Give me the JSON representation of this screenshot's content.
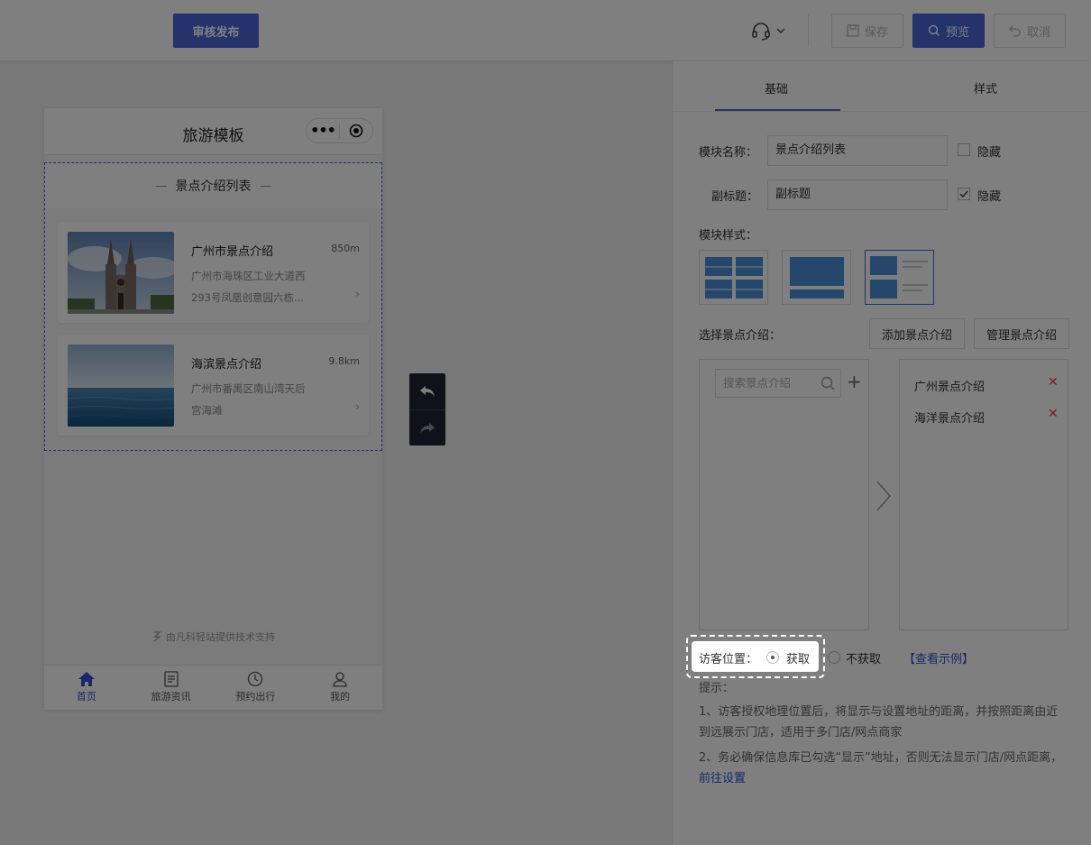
{
  "toolbar": {
    "publish_label": "审核发布",
    "save_label": "保存",
    "preview_label": "预览",
    "cancel_label": "取消"
  },
  "phone": {
    "title": "旅游模板",
    "module_title": "景点介绍列表",
    "cards": [
      {
        "name": "广州市景点介绍",
        "distance": "850m",
        "address_line1": "广州市海珠区工业大道西",
        "address_line2": "293号凤凰创意园六栋..."
      },
      {
        "name": "海滨景点介绍",
        "distance": "9.8km",
        "address_line1": "广州市番禺区南山湾天后",
        "address_line2": "宫海滩"
      }
    ],
    "tech_support": "由凡科轻站提供技术支持",
    "tabs": [
      {
        "label": "首页",
        "active": true
      },
      {
        "label": "旅游资讯",
        "active": false
      },
      {
        "label": "预约出行",
        "active": false
      },
      {
        "label": "我的",
        "active": false
      }
    ]
  },
  "panel": {
    "tab_basic": "基础",
    "tab_style": "样式",
    "module_name_label": "模块名称：",
    "module_name_value": "景点介绍列表",
    "hide_label": "隐藏",
    "subtitle_label": "副标题：",
    "subtitle_value": "副标题",
    "subtitle_hide_checked": true,
    "module_style_label": "模块样式：",
    "select_label": "选择景点介绍：",
    "add_button": "添加景点介绍",
    "manage_button": "管理景点介绍",
    "search_placeholder": "搜索景点介绍",
    "selected_items": [
      "广州景点介绍",
      "海洋景点介绍"
    ],
    "visitor_location_label": "访客位置：",
    "option_get": "获取",
    "option_not_get": "不获取",
    "example_link": "【查看示例】",
    "tips_title": "提示：",
    "tip1": "1、访客授权地理位置后，将显示与设置地址的距离，并按照距离由近到远展示门店，适用于多门店/网点商家",
    "tip2_prefix": "2、务必确保信息库已勾选“显示”地址，否则无法显示门店/网点距离，",
    "tip2_link": "前往设置"
  },
  "colors": {
    "accent": "#4b64d6",
    "link": "#2c53d6",
    "delete": "#e54545"
  }
}
